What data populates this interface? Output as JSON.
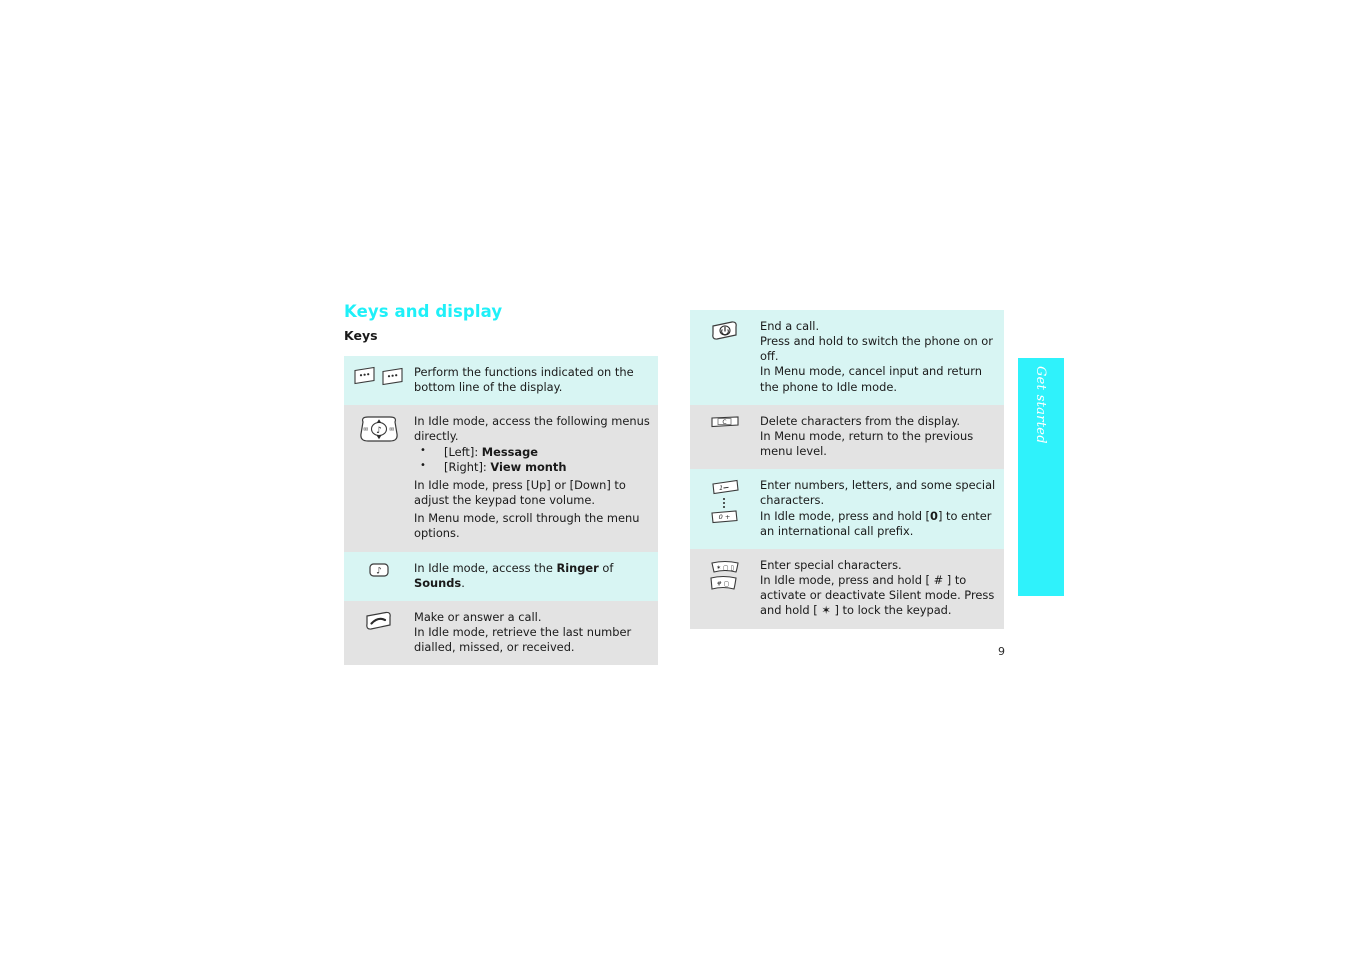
{
  "document": {
    "section_title": "Keys and display",
    "sub_title": "Keys",
    "page_number": "9",
    "side_tab_label": "Get started",
    "colors": {
      "accent_cyan": "#1ff0f8",
      "tab_cyan": "#2ff2fb",
      "row_tint": "#d8f5f3",
      "row_plain": "#e3e3e3",
      "text": "#1a1a1a"
    }
  },
  "left_table": {
    "rows": [
      {
        "icon": "soft-keys-icon",
        "shade": "tint",
        "lines": [
          {
            "type": "paragraph",
            "text": "Perform the functions indicated on the bottom line of the display."
          }
        ]
      },
      {
        "icon": "navigation-key-icon",
        "shade": "plain",
        "lines": [
          {
            "type": "paragraph",
            "text": "In Idle mode, access the following menus directly."
          },
          {
            "type": "bullet",
            "prefix": "[Left]: ",
            "bold": "Message",
            "suffix": ""
          },
          {
            "type": "bullet",
            "prefix": "[Right]: ",
            "bold": "View month",
            "suffix": ""
          },
          {
            "type": "paragraph",
            "text": "In Idle mode, press [Up] or [Down] to adjust the keypad tone volume."
          },
          {
            "type": "paragraph",
            "text": "In Menu mode, scroll through the menu options."
          }
        ]
      },
      {
        "icon": "ringer-key-icon",
        "shade": "tint",
        "lines": [
          {
            "type": "rich",
            "prefix": "In Idle mode, access the ",
            "bold": "Ringer",
            "mid": " of ",
            "bold2": "Sounds",
            "suffix": "."
          }
        ]
      },
      {
        "icon": "call-key-icon",
        "shade": "plain",
        "lines": [
          {
            "type": "paragraph",
            "text": "Make or answer a call."
          },
          {
            "type": "paragraph",
            "text": "In Idle mode, retrieve the last number dialled, missed, or received."
          }
        ]
      }
    ]
  },
  "right_table": {
    "rows": [
      {
        "icon": "end-call-key-icon",
        "shade": "tint",
        "lines": [
          {
            "type": "paragraph",
            "text": "End a call."
          },
          {
            "type": "paragraph",
            "text": "Press and hold to switch the phone on or off."
          },
          {
            "type": "paragraph",
            "text": "In Menu mode, cancel input and return the phone to Idle mode."
          }
        ]
      },
      {
        "icon": "clear-key-icon",
        "shade": "plain",
        "lines": [
          {
            "type": "paragraph",
            "text": "Delete characters from the display."
          },
          {
            "type": "paragraph",
            "text": "In Menu mode, return to the previous menu level."
          }
        ]
      },
      {
        "icon": "number-keys-icon",
        "shade": "tint",
        "lines": [
          {
            "type": "paragraph",
            "text": "Enter numbers, letters, and some special characters."
          },
          {
            "type": "rich2",
            "prefix": "In Idle mode, press and hold [",
            "bold": "0",
            "suffix": "] to enter an international call prefix."
          }
        ]
      },
      {
        "icon": "special-keys-icon",
        "shade": "plain",
        "lines": [
          {
            "type": "paragraph",
            "text": "Enter special characters."
          },
          {
            "type": "paragraph",
            "text": "In Idle mode, press and hold [ # ] to activate or deactivate Silent mode. Press and hold [ ✶ ] to lock the keypad."
          }
        ]
      }
    ]
  }
}
